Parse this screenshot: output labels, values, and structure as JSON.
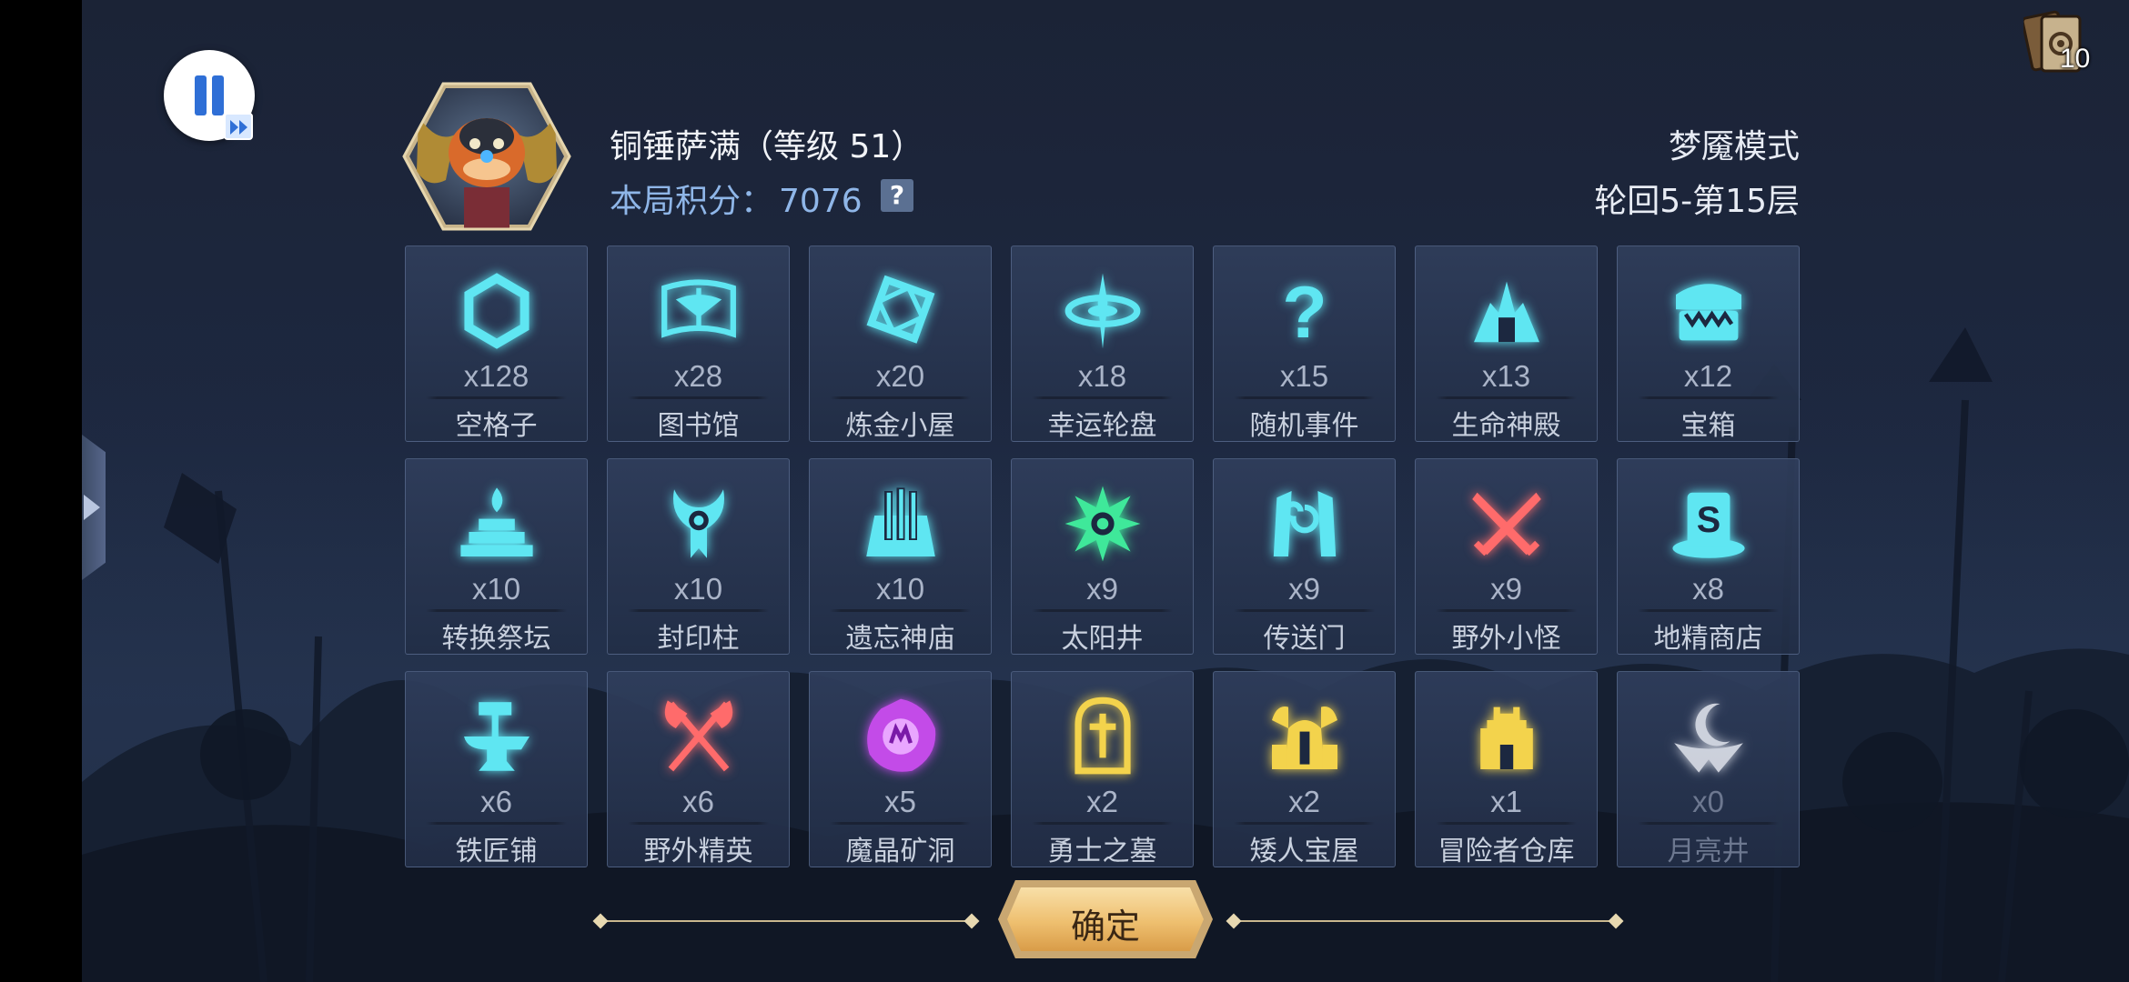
{
  "hero": {
    "name": "铜锤萨满（等级 51）",
    "score_label": "本局积分：",
    "score_value": "7076",
    "help_label": "?"
  },
  "run": {
    "mode": "梦魇模式",
    "floor": "轮回5-第15层"
  },
  "deck": {
    "count": "10"
  },
  "colors": {
    "cyan_icon": "#5fe6f2",
    "green_icon": "#3fe89a",
    "red_icon": "#ff6b6b",
    "purple_icon": "#c34be8",
    "gold_icon": "#f3d34c",
    "white_icon": "#e9ecf4",
    "accent_blue": "#8fb6e8",
    "confirm_gold": "#eebf6f"
  },
  "tiles": [
    {
      "icon": "hexagon-icon",
      "count": "x128",
      "name": "空格子"
    },
    {
      "icon": "library-book-icon",
      "count": "x28",
      "name": "图书馆"
    },
    {
      "icon": "alchemy-rune-icon",
      "count": "x20",
      "name": "炼金小屋"
    },
    {
      "icon": "lucky-wheel-icon",
      "count": "x18",
      "name": "幸运轮盘"
    },
    {
      "icon": "question-mark-icon",
      "count": "x15",
      "name": "随机事件"
    },
    {
      "icon": "life-temple-icon",
      "count": "x13",
      "name": "生命神殿"
    },
    {
      "icon": "treasure-chest-icon",
      "count": "x12",
      "name": "宝箱"
    },
    {
      "icon": "conversion-altar-icon",
      "count": "x10",
      "name": "转换祭坛"
    },
    {
      "icon": "seal-pillar-icon",
      "count": "x10",
      "name": "封印柱"
    },
    {
      "icon": "forgotten-temple-icon",
      "count": "x10",
      "name": "遗忘神庙"
    },
    {
      "icon": "sun-well-icon",
      "count": "x9",
      "name": "太阳井"
    },
    {
      "icon": "portal-icon",
      "count": "x9",
      "name": "传送门"
    },
    {
      "icon": "crossed-swords-icon",
      "count": "x9",
      "name": "野外小怪"
    },
    {
      "icon": "goblin-shop-icon",
      "count": "x8",
      "name": "地精商店"
    },
    {
      "icon": "anvil-hammer-icon",
      "count": "x6",
      "name": "铁匠铺"
    },
    {
      "icon": "crossed-axes-icon",
      "count": "x6",
      "name": "野外精英"
    },
    {
      "icon": "magic-crystal-icon",
      "count": "x5",
      "name": "魔晶矿洞"
    },
    {
      "icon": "tombstone-icon",
      "count": "x2",
      "name": "勇士之墓"
    },
    {
      "icon": "dwarf-helmet-icon",
      "count": "x2",
      "name": "矮人宝屋"
    },
    {
      "icon": "castle-warehouse-icon",
      "count": "x1",
      "name": "冒险者仓库"
    },
    {
      "icon": "moon-well-icon",
      "count": "x0",
      "name": "月亮井"
    }
  ],
  "confirm": {
    "label": "确定"
  }
}
